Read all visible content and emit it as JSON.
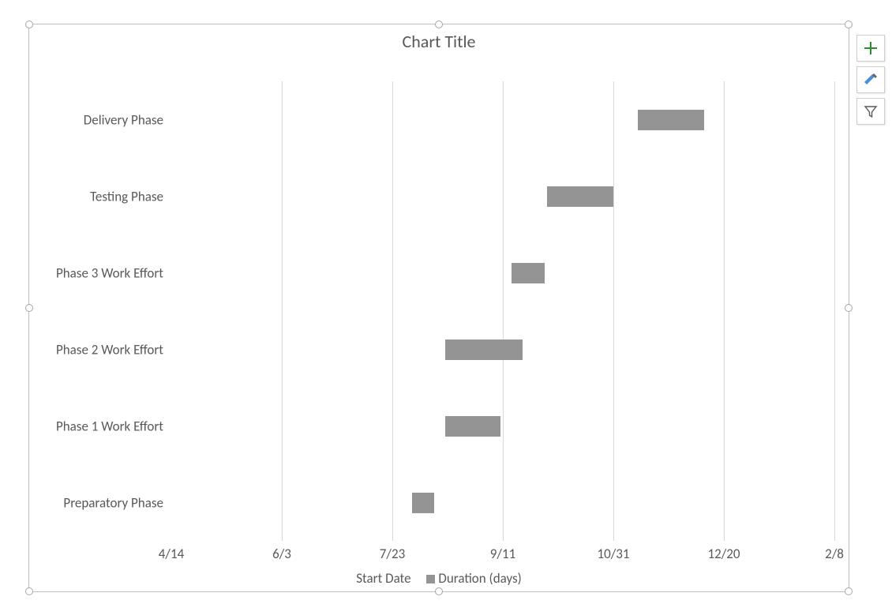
{
  "chart_data": {
    "type": "bar",
    "orientation": "horizontal-stacked-gantt",
    "title": "Chart Title",
    "x_ticks": [
      "4/14",
      "6/3",
      "7/23",
      "9/11",
      "10/31",
      "12/20",
      "2/8"
    ],
    "x_tick_serials": [
      42838,
      42888,
      42938,
      42988,
      43038,
      43088,
      43138
    ],
    "x_range": [
      42838,
      43138
    ],
    "categories": [
      "Preparatory Phase",
      "Phase 1 Work Effort",
      "Phase 2 Work Effort",
      "Phase 3 Work Effort",
      "Testing Phase",
      "Delivery Phase"
    ],
    "series": [
      {
        "name": "Start Date",
        "role": "invisible-offset",
        "values": [
          42947,
          42962,
          42962,
          42992,
          43008,
          43049
        ]
      },
      {
        "name": "Duration (days)",
        "role": "visible-bar",
        "values": [
          10,
          25,
          35,
          15,
          30,
          30
        ]
      }
    ],
    "legend": [
      "Start Date",
      "Duration (days)"
    ],
    "legend_position": "bottom",
    "grid": {
      "vertical": true,
      "horizontal": false
    },
    "bar_color": "#949494"
  },
  "context_buttons": {
    "elements_tooltip": "Chart Elements",
    "styles_tooltip": "Chart Styles",
    "filter_tooltip": "Chart Filters"
  }
}
